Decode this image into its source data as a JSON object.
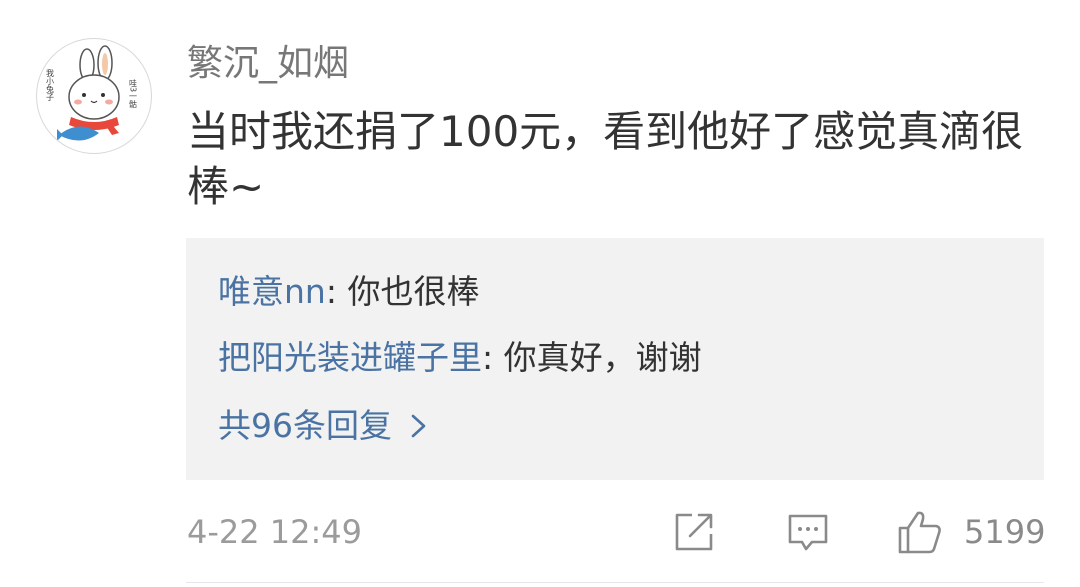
{
  "comment": {
    "author": "繁沉_如烟",
    "text": "当时我还捐了100元，看到他好了感觉真滴很棒~",
    "avatar_icon": "bunny-avatar-icon",
    "avatar_doodle_left": "我小兔子",
    "avatar_doodle_right": "哇3一骷",
    "timestamp": "4-22 12:49",
    "like_count": "5199"
  },
  "replies": [
    {
      "author": "唯意nn",
      "separator": ": ",
      "text": "你也很棒"
    },
    {
      "author": "把阳光装进罐子里",
      "separator": ": ",
      "text": "你真好，谢谢"
    }
  ],
  "more_replies_label": "共96条回复",
  "icons": {
    "share": "share-edit-icon",
    "comment": "comment-bubble-icon",
    "like": "thumbs-up-icon",
    "more": "chevron-right-icon"
  },
  "colors": {
    "link": "#4a73a3",
    "text": "#333333",
    "meta": "#9b9b9b",
    "reply_bg": "#f2f2f2"
  }
}
